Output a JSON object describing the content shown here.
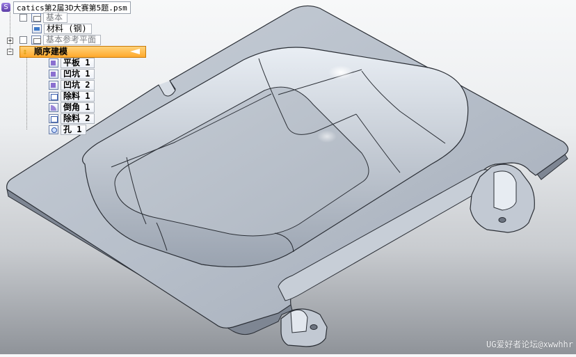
{
  "file": {
    "name": "catics第2届3D大赛第5题.psm",
    "app_icon": "S"
  },
  "tree": {
    "base": "基本",
    "material": "材料 (钢)",
    "ref_planes": "基本参考平面",
    "ordered": "顺序建模",
    "features": [
      {
        "label": "平板 1",
        "icon": "part-icon"
      },
      {
        "label": "凹坑 1",
        "icon": "dimple-icon"
      },
      {
        "label": "凹坑 2",
        "icon": "dimple-icon"
      },
      {
        "label": "除料 1",
        "icon": "cutout-icon"
      },
      {
        "label": "倒角 1",
        "icon": "chamfer-icon"
      },
      {
        "label": "除料 2",
        "icon": "cutout-icon"
      },
      {
        "label": "孔 1",
        "icon": "hole-icon"
      }
    ]
  },
  "watermark": "UG爱好者论坛@xwwhhr",
  "colors": {
    "active_highlight": "#ffb23a",
    "part_fill": "#b4bdc8",
    "edge": "#2a2e35"
  }
}
